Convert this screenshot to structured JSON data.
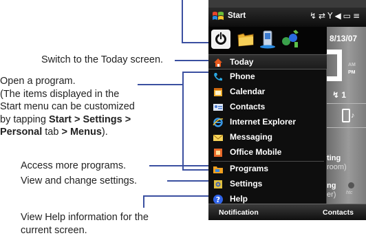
{
  "callouts": {
    "today": "Switch to the Today screen.",
    "open_program": {
      "line1": "Open a program.",
      "line2": "(The items displayed in the",
      "line3": "Start menu can be customized",
      "line4_pre": "by tapping ",
      "line4_bold": "Start > Settings >",
      "line5_bold_a": "Personal",
      "line5_mid": " tab ",
      "line5_bold_b": "> Menus",
      "line5_post": ")."
    },
    "more_programs": "Access more programs.",
    "settings": "View and change settings.",
    "help": {
      "line1": "View Help information for the",
      "line2": "current screen."
    }
  },
  "device": {
    "title": "Start",
    "status_icons": [
      "signal-icon",
      "data-arrows-icon",
      "antenna-icon",
      "speaker-icon",
      "battery-icon",
      "menu-lines-icon"
    ],
    "status_glyphs": "↯⇄Y◀▭≡",
    "icon_bar": [
      "power-icon",
      "folder-icon",
      "phone-device-icon",
      "communication-icon"
    ],
    "menu_items": [
      {
        "label": "Today",
        "icon": "today-house-icon",
        "color": "#e85a1e"
      },
      {
        "label": "Phone",
        "icon": "phone-handset-icon",
        "color": "#2aa6e0"
      },
      {
        "label": "Calendar",
        "icon": "calendar-icon",
        "color": "#f0b030"
      },
      {
        "label": "Contacts",
        "icon": "contacts-card-icon",
        "color": "#4a7ad0"
      },
      {
        "label": "Internet Explorer",
        "icon": "internet-explorer-icon",
        "color": "#3a9ae8"
      },
      {
        "label": "Messaging",
        "icon": "messaging-envelope-icon",
        "color": "#e8c040"
      },
      {
        "label": "Office Mobile",
        "icon": "office-mobile-icon",
        "color": "#e86a2a"
      },
      {
        "label": "Programs",
        "icon": "programs-folder-icon",
        "color": "#f0a020"
      },
      {
        "label": "Settings",
        "icon": "settings-icon",
        "color": "#e0c040"
      },
      {
        "label": "Help",
        "icon": "help-icon",
        "color": "#2f63e8"
      }
    ],
    "today_screen": {
      "date": "8/13/07",
      "am": "AM",
      "pm": "PM",
      "count": "1",
      "tile1_a": "ting",
      "tile1_b": "room)",
      "tile2_a": "ng",
      "tile2_b": "er)",
      "logo": "htc"
    },
    "softkeys": {
      "left": "Notification",
      "right": "Contacts"
    }
  }
}
